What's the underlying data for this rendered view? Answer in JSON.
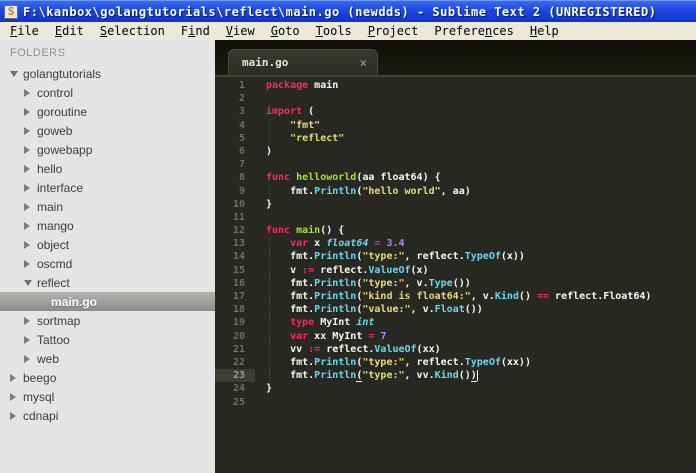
{
  "window": {
    "title": "F:\\kanbox\\golangtutorials\\reflect\\main.go (newdds) - Sublime Text 2 (UNREGISTERED)",
    "icon_glyph": "S"
  },
  "menu": {
    "items": [
      {
        "label": "File",
        "underline_index": 0
      },
      {
        "label": "Edit",
        "underline_index": 0
      },
      {
        "label": "Selection",
        "underline_index": 0
      },
      {
        "label": "Find",
        "underline_index": 1
      },
      {
        "label": "View",
        "underline_index": 0
      },
      {
        "label": "Goto",
        "underline_index": 0
      },
      {
        "label": "Tools",
        "underline_index": 0
      },
      {
        "label": "Project",
        "underline_index": 0
      },
      {
        "label": "Preferences",
        "underline_index": 7
      },
      {
        "label": "Help",
        "underline_index": 0
      }
    ]
  },
  "sidebar": {
    "header": "FOLDERS",
    "tree": [
      {
        "label": "golangtutorials",
        "level": 0,
        "type": "dir",
        "state": "expanded",
        "selected": false
      },
      {
        "label": "control",
        "level": 1,
        "type": "dir",
        "state": "collapsed",
        "selected": false
      },
      {
        "label": "goroutine",
        "level": 1,
        "type": "dir",
        "state": "collapsed",
        "selected": false
      },
      {
        "label": "goweb",
        "level": 1,
        "type": "dir",
        "state": "collapsed",
        "selected": false
      },
      {
        "label": "gowebapp",
        "level": 1,
        "type": "dir",
        "state": "collapsed",
        "selected": false
      },
      {
        "label": "hello",
        "level": 1,
        "type": "dir",
        "state": "collapsed",
        "selected": false
      },
      {
        "label": "interface",
        "level": 1,
        "type": "dir",
        "state": "collapsed",
        "selected": false
      },
      {
        "label": "main",
        "level": 1,
        "type": "dir",
        "state": "collapsed",
        "selected": false
      },
      {
        "label": "mango",
        "level": 1,
        "type": "dir",
        "state": "collapsed",
        "selected": false
      },
      {
        "label": "object",
        "level": 1,
        "type": "dir",
        "state": "collapsed",
        "selected": false
      },
      {
        "label": "oscmd",
        "level": 1,
        "type": "dir",
        "state": "collapsed",
        "selected": false
      },
      {
        "label": "reflect",
        "level": 1,
        "type": "dir",
        "state": "expanded",
        "selected": false
      },
      {
        "label": "main.go",
        "level": 2,
        "type": "file",
        "state": null,
        "selected": true
      },
      {
        "label": "sortmap",
        "level": 1,
        "type": "dir",
        "state": "collapsed",
        "selected": false
      },
      {
        "label": "Tattoo",
        "level": 1,
        "type": "dir",
        "state": "collapsed",
        "selected": false
      },
      {
        "label": "web",
        "level": 1,
        "type": "dir",
        "state": "collapsed",
        "selected": false
      },
      {
        "label": "beego",
        "level": 0,
        "type": "dir",
        "state": "collapsed",
        "selected": false
      },
      {
        "label": "mysql",
        "level": 0,
        "type": "dir",
        "state": "collapsed",
        "selected": false
      },
      {
        "label": "cdnapi",
        "level": 0,
        "type": "dir",
        "state": "collapsed",
        "selected": false
      }
    ]
  },
  "editor": {
    "tab": {
      "label": "main.go",
      "close_glyph": "×"
    },
    "active_line": 23,
    "cursor_line": 23,
    "code": {
      "language": "go",
      "lines": [
        {
          "no": 1,
          "guide": false,
          "tokens": [
            [
              "k",
              "package"
            ],
            [
              "p",
              " main"
            ]
          ]
        },
        {
          "no": 2,
          "guide": false,
          "tokens": []
        },
        {
          "no": 3,
          "guide": false,
          "tokens": [
            [
              "k",
              "import"
            ],
            [
              "p",
              " ("
            ]
          ]
        },
        {
          "no": 4,
          "guide": true,
          "tokens": [
            [
              "p",
              "    "
            ],
            [
              "s",
              "\"fmt\""
            ]
          ]
        },
        {
          "no": 5,
          "guide": true,
          "tokens": [
            [
              "p",
              "    "
            ],
            [
              "s",
              "\"reflect\""
            ]
          ]
        },
        {
          "no": 6,
          "guide": false,
          "tokens": [
            [
              "p",
              ")"
            ]
          ]
        },
        {
          "no": 7,
          "guide": false,
          "tokens": []
        },
        {
          "no": 8,
          "guide": false,
          "tokens": [
            [
              "k",
              "func"
            ],
            [
              "p",
              " "
            ],
            [
              "f",
              "helloworld"
            ],
            [
              "p",
              "(aa float64) {"
            ]
          ]
        },
        {
          "no": 9,
          "guide": true,
          "tokens": [
            [
              "p",
              "    fmt."
            ],
            [
              "u",
              "Println"
            ],
            [
              "p",
              "("
            ],
            [
              "s",
              "\"hello world\""
            ],
            [
              "p",
              ", aa)"
            ]
          ]
        },
        {
          "no": 10,
          "guide": false,
          "tokens": [
            [
              "p",
              "}"
            ]
          ]
        },
        {
          "no": 11,
          "guide": false,
          "tokens": []
        },
        {
          "no": 12,
          "guide": false,
          "tokens": [
            [
              "k",
              "func"
            ],
            [
              "p",
              " "
            ],
            [
              "f",
              "main"
            ],
            [
              "p",
              "() {"
            ]
          ]
        },
        {
          "no": 13,
          "guide": true,
          "tokens": [
            [
              "p",
              "    "
            ],
            [
              "k",
              "var"
            ],
            [
              "p",
              " x "
            ],
            [
              "t",
              "float64"
            ],
            [
              "p",
              " "
            ],
            [
              "o",
              "="
            ],
            [
              "p",
              " "
            ],
            [
              "n",
              "3.4"
            ]
          ]
        },
        {
          "no": 14,
          "guide": true,
          "tokens": [
            [
              "p",
              "    fmt."
            ],
            [
              "u",
              "Println"
            ],
            [
              "p",
              "("
            ],
            [
              "s",
              "\"type:\""
            ],
            [
              "p",
              ", reflect."
            ],
            [
              "u",
              "TypeOf"
            ],
            [
              "p",
              "(x))"
            ]
          ]
        },
        {
          "no": 15,
          "guide": true,
          "tokens": [
            [
              "p",
              "    v "
            ],
            [
              "o",
              ":="
            ],
            [
              "p",
              " reflect."
            ],
            [
              "u",
              "ValueOf"
            ],
            [
              "p",
              "(x)"
            ]
          ]
        },
        {
          "no": 16,
          "guide": true,
          "tokens": [
            [
              "p",
              "    fmt."
            ],
            [
              "u",
              "Println"
            ],
            [
              "p",
              "("
            ],
            [
              "s",
              "\"type:\""
            ],
            [
              "p",
              ", v."
            ],
            [
              "u",
              "Type"
            ],
            [
              "p",
              "())"
            ]
          ]
        },
        {
          "no": 17,
          "guide": true,
          "tokens": [
            [
              "p",
              "    fmt."
            ],
            [
              "u",
              "Println"
            ],
            [
              "p",
              "("
            ],
            [
              "s",
              "\"kind is float64:\""
            ],
            [
              "p",
              ", v."
            ],
            [
              "u",
              "Kind"
            ],
            [
              "p",
              "() "
            ],
            [
              "o",
              "=="
            ],
            [
              "p",
              " reflect.Float64)"
            ]
          ]
        },
        {
          "no": 18,
          "guide": true,
          "tokens": [
            [
              "p",
              "    fmt."
            ],
            [
              "u",
              "Println"
            ],
            [
              "p",
              "("
            ],
            [
              "s",
              "\"value:\""
            ],
            [
              "p",
              ", v."
            ],
            [
              "u",
              "Float"
            ],
            [
              "p",
              "())"
            ]
          ]
        },
        {
          "no": 19,
          "guide": true,
          "tokens": [
            [
              "p",
              "    "
            ],
            [
              "k",
              "type"
            ],
            [
              "p",
              " MyInt "
            ],
            [
              "t",
              "int"
            ]
          ]
        },
        {
          "no": 20,
          "guide": true,
          "tokens": [
            [
              "p",
              "    "
            ],
            [
              "k",
              "var"
            ],
            [
              "p",
              " xx MyInt "
            ],
            [
              "o",
              "="
            ],
            [
              "p",
              " "
            ],
            [
              "n",
              "7"
            ]
          ]
        },
        {
          "no": 21,
          "guide": true,
          "tokens": [
            [
              "p",
              "    vv "
            ],
            [
              "o",
              ":="
            ],
            [
              "p",
              " reflect."
            ],
            [
              "u",
              "ValueOf"
            ],
            [
              "p",
              "(xx)"
            ]
          ]
        },
        {
          "no": 22,
          "guide": true,
          "tokens": [
            [
              "p",
              "    fmt."
            ],
            [
              "u",
              "Println"
            ],
            [
              "p",
              "("
            ],
            [
              "s",
              "\"type:\""
            ],
            [
              "p",
              ", reflect."
            ],
            [
              "u",
              "TypeOf"
            ],
            [
              "p",
              "(xx))"
            ]
          ]
        },
        {
          "no": 23,
          "guide": true,
          "tokens": [
            [
              "p",
              "    fmt."
            ],
            [
              "u",
              "Println"
            ],
            [
              "p ul",
              "("
            ],
            [
              "s",
              "\"type:\""
            ],
            [
              "p",
              ", vv."
            ],
            [
              "u",
              "Kind"
            ],
            [
              "p",
              "()"
            ],
            [
              "p ul",
              ")"
            ]
          ]
        },
        {
          "no": 24,
          "guide": false,
          "tokens": [
            [
              "p",
              "}"
            ]
          ]
        },
        {
          "no": 25,
          "guide": false,
          "tokens": []
        }
      ]
    }
  },
  "colors": {
    "title_bar": "#0f33cf",
    "menu_bg": "#ece9d8",
    "sidebar_bg": "#e5e5e5",
    "editor_bg": "#272822",
    "tabbar_bg": "#191a12",
    "line_highlight": "#3e3d32",
    "gutter_text": "#6e6f64",
    "fg": "#f8f8f2",
    "kw": "#f92672",
    "fn": "#a6e22e",
    "ty": "#66d9ef",
    "su": "#66d9ef",
    "st": "#e6db74",
    "nu": "#ae81ff"
  }
}
